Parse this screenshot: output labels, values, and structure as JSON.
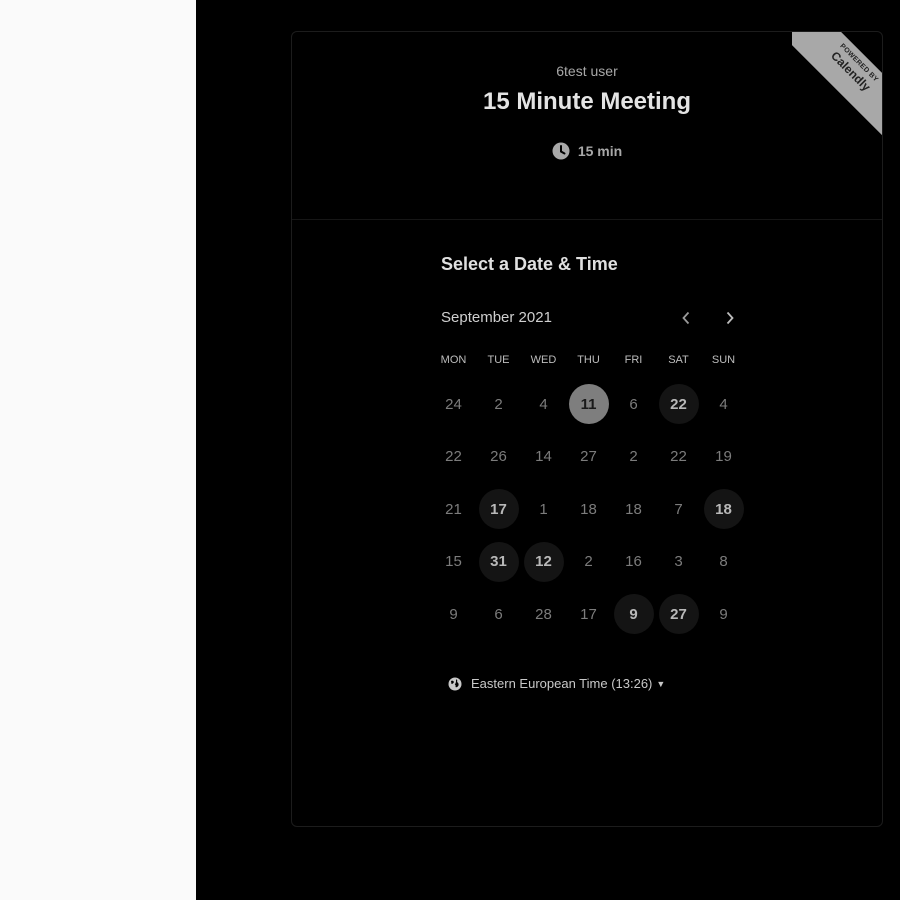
{
  "ribbon": {
    "powered_by": "POWERED BY",
    "brand": "Calendly"
  },
  "event": {
    "host": "6test user",
    "title": "15 Minute Meeting",
    "duration": "15 min",
    "duration_icon": "clock-icon"
  },
  "scheduler": {
    "heading": "Select a Date & Time",
    "month_label": "September 2021",
    "prev_icon": "chevron-left-icon",
    "next_icon": "chevron-right-icon",
    "weekdays": [
      "MON",
      "TUE",
      "WED",
      "THU",
      "FRI",
      "SAT",
      "SUN"
    ],
    "weeks": [
      [
        {
          "day": "24",
          "state": "normal"
        },
        {
          "day": "2",
          "state": "normal"
        },
        {
          "day": "4",
          "state": "normal"
        },
        {
          "day": "11",
          "state": "selected"
        },
        {
          "day": "6",
          "state": "normal"
        },
        {
          "day": "22",
          "state": "available"
        },
        {
          "day": "4",
          "state": "normal"
        }
      ],
      [
        {
          "day": "22",
          "state": "normal"
        },
        {
          "day": "26",
          "state": "normal"
        },
        {
          "day": "14",
          "state": "normal"
        },
        {
          "day": "27",
          "state": "normal"
        },
        {
          "day": "2",
          "state": "normal"
        },
        {
          "day": "22",
          "state": "normal"
        },
        {
          "day": "19",
          "state": "normal"
        }
      ],
      [
        {
          "day": "21",
          "state": "normal"
        },
        {
          "day": "17",
          "state": "available"
        },
        {
          "day": "1",
          "state": "normal"
        },
        {
          "day": "18",
          "state": "normal"
        },
        {
          "day": "18",
          "state": "normal"
        },
        {
          "day": "7",
          "state": "normal"
        },
        {
          "day": "18",
          "state": "available"
        }
      ],
      [
        {
          "day": "15",
          "state": "normal"
        },
        {
          "day": "31",
          "state": "available"
        },
        {
          "day": "12",
          "state": "available"
        },
        {
          "day": "2",
          "state": "normal"
        },
        {
          "day": "16",
          "state": "normal"
        },
        {
          "day": "3",
          "state": "normal"
        },
        {
          "day": "8",
          "state": "normal"
        }
      ],
      [
        {
          "day": "9",
          "state": "normal"
        },
        {
          "day": "6",
          "state": "normal"
        },
        {
          "day": "28",
          "state": "normal"
        },
        {
          "day": "17",
          "state": "normal"
        },
        {
          "day": "9",
          "state": "available"
        },
        {
          "day": "27",
          "state": "available"
        },
        {
          "day": "9",
          "state": "normal"
        }
      ]
    ],
    "timezone": "Eastern European Time (13:26)",
    "timezone_icon": "globe-icon"
  },
  "colors": {
    "background": "#000000",
    "left_panel": "#fafafa",
    "selected_day": "#7e7e7e",
    "available_day": "#141414",
    "ribbon": "#a8a8a8"
  }
}
